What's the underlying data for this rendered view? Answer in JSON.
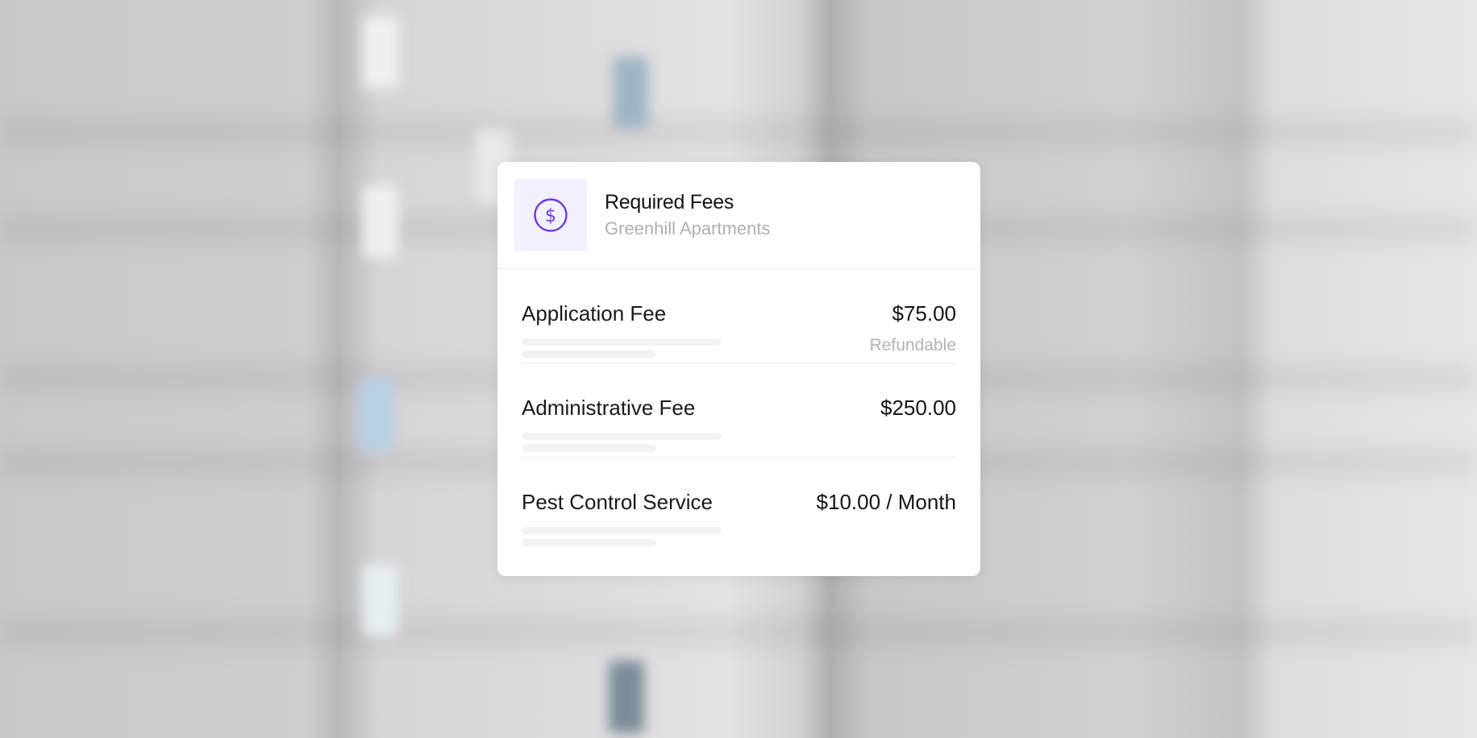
{
  "card": {
    "title": "Required Fees",
    "subtitle": "Greenhill Apartments",
    "icon": "dollar-circle-icon",
    "accent_color": "#6d3be0"
  },
  "fees": [
    {
      "name": "Application Fee",
      "amount": "$75.00",
      "note": "Refundable"
    },
    {
      "name": "Administrative Fee",
      "amount": "$250.00",
      "note": ""
    },
    {
      "name": "Pest Control Service",
      "amount": "$10.00 / Month",
      "note": ""
    }
  ]
}
